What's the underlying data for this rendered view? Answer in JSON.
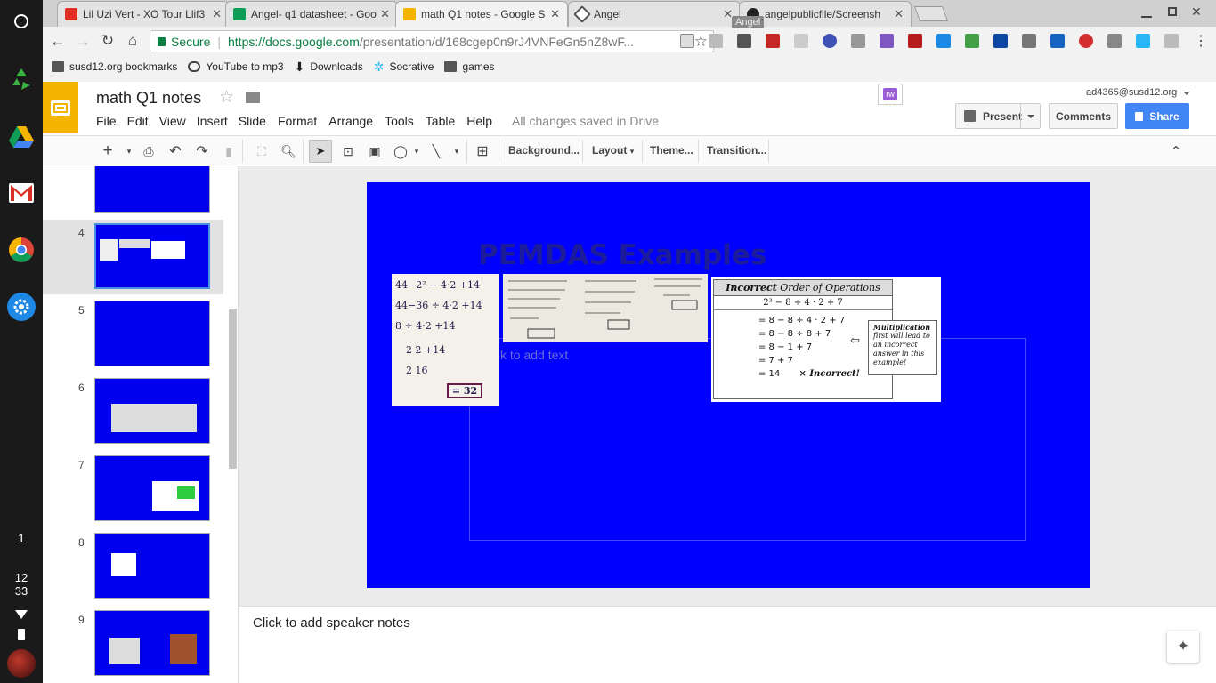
{
  "os": {
    "shelf_time_hour": "12",
    "shelf_time_min": "33",
    "shelf_badge": "1"
  },
  "browser": {
    "tabs": [
      {
        "title": "Lil Uzi Vert - XO Tour Llif3",
        "color": "#e52d27"
      },
      {
        "title": "Angel- q1 datasheet - Goo",
        "color": "#0f9d58"
      },
      {
        "title": "math Q1 notes - Google S",
        "color": "#f4b400"
      },
      {
        "title": "Angel",
        "color": "#555555"
      },
      {
        "title": "angelpublicfile/Screensh",
        "color": "#222222"
      }
    ],
    "tab_tooltip": "Angel",
    "secure_label": "Secure",
    "url_domain": "https://docs.google.com",
    "url_path": "/presentation/d/168cgep0n9rJ4VNFeGn5nZ8wF...",
    "bookmarks": [
      {
        "label": "susd12.org bookmarks",
        "icon": "folder-icon"
      },
      {
        "label": "YouTube to mp3",
        "icon": "download-cloud-icon"
      },
      {
        "label": "Downloads",
        "icon": "download-icon"
      },
      {
        "label": "Socrative",
        "icon": "socrative-icon"
      },
      {
        "label": "games",
        "icon": "folder-icon"
      }
    ]
  },
  "docs": {
    "title": "math Q1 notes",
    "menu": [
      "File",
      "Edit",
      "View",
      "Insert",
      "Slide",
      "Format",
      "Arrange",
      "Tools",
      "Table",
      "Help"
    ],
    "save_status": "All changes saved in Drive",
    "account": "ad4365@susd12.org",
    "present_label": "Present",
    "comments_label": "Comments",
    "share_label": "Share",
    "addon_badge": "rw",
    "toolbar": {
      "background": "Background...",
      "layout": "Layout",
      "theme": "Theme...",
      "transition": "Transition..."
    },
    "filmstrip_numbers": [
      "4",
      "5",
      "6",
      "7",
      "8",
      "9"
    ],
    "slide": {
      "title": "PEMDAS Examples",
      "placeholder": "k to add text",
      "board_title_bold": "Incorrect",
      "board_title_rest": " Order of Operations",
      "board_expression": "2³ − 8 ÷ 4 · 2 + 7",
      "board_steps": [
        "= 8 − 8 ÷ 4 · 2 + 7",
        "= 8 − 8 ÷ 8 + 7",
        "= 8 − 1 + 7",
        "= 7 + 7",
        "= 14"
      ],
      "board_incorrect": "× Incorrect!",
      "callout_title": "Multiplication",
      "callout_body": "first will lead to an incorrect answer in this example!",
      "hand_lines": [
        "44−2² − 4·2 +14",
        "44−36 ÷ 4·2 +14",
        "8  ÷  4·2 +14",
        "2    2 +14",
        "2   16"
      ],
      "hand_answer": "= 32"
    },
    "notes_placeholder": "Click to add speaker notes"
  }
}
